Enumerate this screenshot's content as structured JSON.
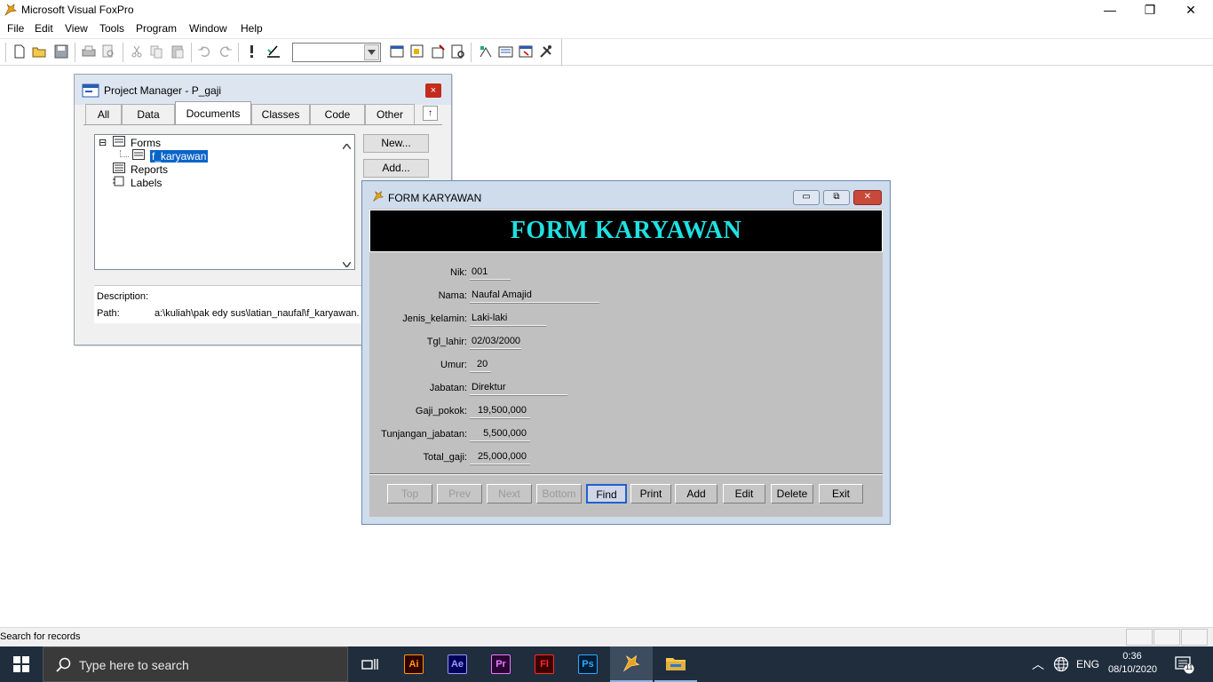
{
  "app": {
    "title": "Microsoft Visual FoxPro",
    "controls": {
      "minimize": "—",
      "restore": "❐",
      "close": "✕"
    }
  },
  "menu": [
    "File",
    "Edit",
    "View",
    "Tools",
    "Program",
    "Window",
    "Help"
  ],
  "toolbar": {
    "combo_value": "",
    "icons": [
      "new-icon",
      "open-icon",
      "save-icon",
      "print-icon",
      "print-preview-icon",
      "cut-icon",
      "copy-icon",
      "paste-icon",
      "undo-icon",
      "redo-icon",
      "run-icon",
      "modify-icon",
      "command-window-icon",
      "view-window-icon",
      "data-session-icon",
      "report-designer-icon",
      "form-designer-icon",
      "form-wizard-icon",
      "code-icon",
      "tools-icon"
    ]
  },
  "project_manager": {
    "title": "Project Manager - P_gaji",
    "close": "×",
    "pin": "↑",
    "tabs": [
      "All",
      "Data",
      "Documents",
      "Classes",
      "Code",
      "Other"
    ],
    "active_tab": "Documents",
    "tree": {
      "expander": "⊟",
      "forms": "Forms",
      "selected_form": "f_karyawan",
      "reports": "Reports",
      "labels": "Labels"
    },
    "buttons": {
      "new": "New...",
      "add": "Add..."
    },
    "description_label": "Description:",
    "description_value": "",
    "path_label": "Path:",
    "path_value": "a:\\kuliah\\pak edy sus\\latian_naufal\\f_karyawan."
  },
  "form_window": {
    "title": "FORM KARYAWAN",
    "header": "FORM KARYAWAN",
    "controls": {
      "minimize": "▭",
      "restore": "⧉",
      "close": "✕"
    },
    "fields": [
      {
        "label": "Nik:",
        "value": "001"
      },
      {
        "label": "Nama:",
        "value": "Naufal Amajid"
      },
      {
        "label": "Jenis_kelamin:",
        "value": "Laki-laki"
      },
      {
        "label": "Tgl_lahir:",
        "value": "02/03/2000"
      },
      {
        "label": "Umur:",
        "value": "20"
      },
      {
        "label": "Jabatan:",
        "value": "Direktur"
      },
      {
        "label": "Gaji_pokok:",
        "value": "19,500,000"
      },
      {
        "label": "Tunjangan_jabatan:",
        "value": "5,500,000"
      },
      {
        "label": "Total_gaji:",
        "value": "25,000,000"
      }
    ],
    "nav_buttons": [
      {
        "label": "Top",
        "enabled": false
      },
      {
        "label": "Prev",
        "enabled": false
      },
      {
        "label": "Next",
        "enabled": false
      },
      {
        "label": "Bottom",
        "enabled": false
      },
      {
        "label": "Find",
        "enabled": true
      },
      {
        "label": "Print",
        "enabled": true
      },
      {
        "label": "Add",
        "enabled": true
      },
      {
        "label": "Edit",
        "enabled": true
      },
      {
        "label": "Delete",
        "enabled": true
      },
      {
        "label": "Exit",
        "enabled": true
      }
    ]
  },
  "statusbar": {
    "text": "Search for records"
  },
  "taskbar": {
    "search_placeholder": "Type here to search",
    "apps": [
      {
        "name": "Adobe Illustrator",
        "short": "Ai",
        "color": "#ff9a00"
      },
      {
        "name": "Adobe After Effects",
        "short": "Ae",
        "color": "#9999ff"
      },
      {
        "name": "Adobe Premiere",
        "short": "Pr",
        "color": "#ea77ff"
      },
      {
        "name": "Adobe Flash",
        "short": "Fl",
        "color": "#ff2a2a"
      },
      {
        "name": "Adobe Photoshop",
        "short": "Ps",
        "color": "#31a8ff"
      }
    ],
    "language": "ENG",
    "time": "0:36",
    "date": "08/10/2020",
    "notification_count": "11",
    "tray_chevron": "︿"
  }
}
